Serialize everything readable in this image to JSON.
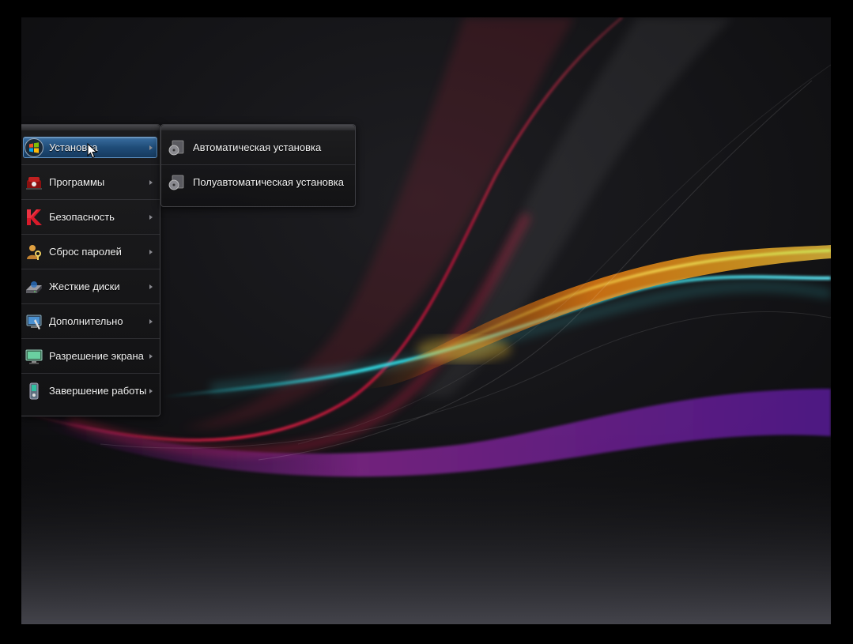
{
  "menu": {
    "items": [
      {
        "label": "Установка",
        "icon": "windows-logo-icon",
        "active": true
      },
      {
        "label": "Программы",
        "icon": "programs-icon"
      },
      {
        "label": "Безопасность",
        "icon": "kaspersky-icon"
      },
      {
        "label": "Сброс паролей",
        "icon": "user-key-icon"
      },
      {
        "label": "Жесткие диски",
        "icon": "hard-drive-icon"
      },
      {
        "label": "Дополнительно",
        "icon": "tools-icon"
      },
      {
        "label": "Разрешение экрана",
        "icon": "monitor-icon"
      },
      {
        "label": "Завершение работы",
        "icon": "shutdown-icon"
      }
    ]
  },
  "submenu": {
    "items": [
      {
        "label": "Автоматическая установка",
        "icon": "disc-install-icon"
      },
      {
        "label": "Полуавтоматическая установка",
        "icon": "disc-install-icon"
      }
    ]
  },
  "colors": {
    "highlight": "#1f4c78",
    "menu_bg": "#1c1c1e",
    "text": "#f2f2f2"
  }
}
